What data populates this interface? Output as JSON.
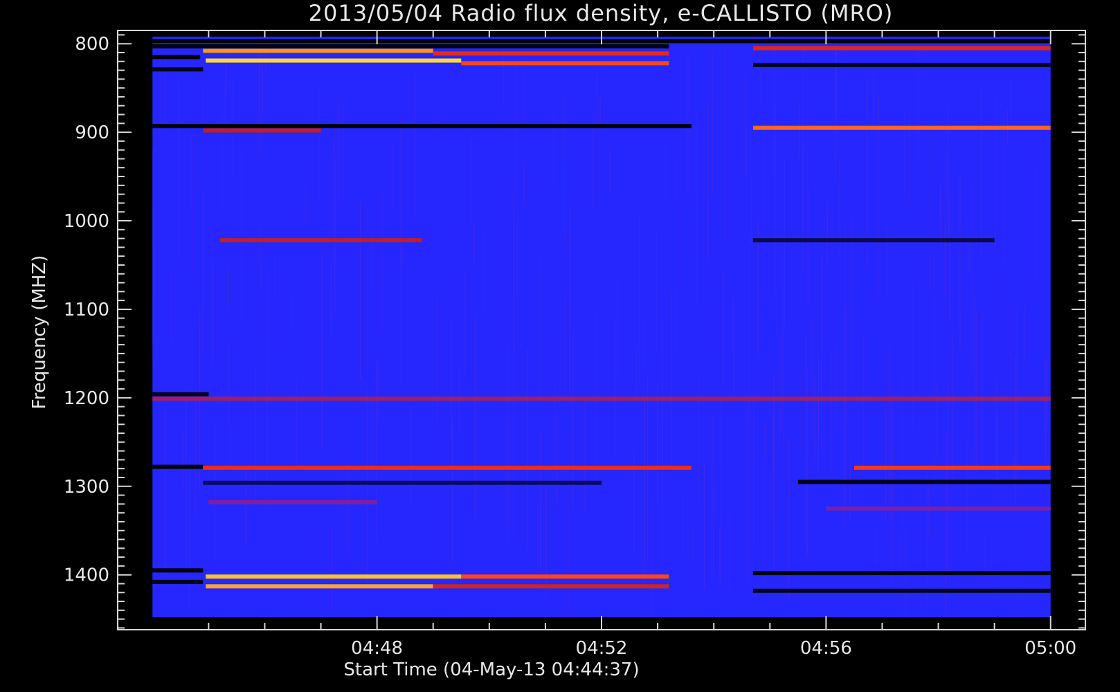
{
  "chart_data": {
    "type": "heatmap",
    "title": "2013/05/04  Radio flux density, e-CALLISTO (MRO)",
    "xlabel": "Start Time (04-May-13 04:44:37)",
    "ylabel": "Frequency (MHZ)",
    "x_start": "04:44:37",
    "x_end": "05:00:00",
    "xlim_minutes": [
      -0.62,
      16.62
    ],
    "ylim": [
      1462,
      785
    ],
    "y_data_range": [
      792,
      1448
    ],
    "y_inverted": true,
    "x_ticks": [
      {
        "label": "04:48",
        "minute": 4
      },
      {
        "label": "04:52",
        "minute": 8
      },
      {
        "label": "04:56",
        "minute": 12
      },
      {
        "label": "05:00",
        "minute": 16
      }
    ],
    "y_ticks": [
      {
        "label": "800",
        "value": 800
      },
      {
        "label": "900",
        "value": 900
      },
      {
        "label": "1000",
        "value": 1000
      },
      {
        "label": "1100",
        "value": 1100
      },
      {
        "label": "1200",
        "value": 1200
      },
      {
        "label": "1300",
        "value": 1300
      },
      {
        "label": "1400",
        "value": 1400
      }
    ],
    "x_minor_step": 1,
    "y_minor_step": 10,
    "colormap": [
      "#000000",
      "#0a0a4a",
      "#1a1aff",
      "#3030ff",
      "#8020a0",
      "#c02020",
      "#ff3010",
      "#ff9020",
      "#ffff40"
    ],
    "background_level": 0.32,
    "bands": [
      {
        "freq": 797,
        "t0": 0.0,
        "t1": 16.0,
        "level": 0.0
      },
      {
        "freq": 803,
        "t0": 0.0,
        "t1": 9.2,
        "level": 0.02
      },
      {
        "freq": 805,
        "t0": 10.7,
        "t1": 16.0,
        "level": 0.68
      },
      {
        "freq": 808,
        "t0": 0.9,
        "t1": 5.0,
        "level": 0.88
      },
      {
        "freq": 811,
        "t0": 5.0,
        "t1": 9.2,
        "level": 0.7
      },
      {
        "freq": 815,
        "t0": 0.0,
        "t1": 0.85,
        "level": 0.0
      },
      {
        "freq": 819,
        "t0": 0.95,
        "t1": 5.5,
        "level": 0.96
      },
      {
        "freq": 822,
        "t0": 5.5,
        "t1": 9.2,
        "level": 0.78
      },
      {
        "freq": 824,
        "t0": 10.7,
        "t1": 16.0,
        "level": 0.05
      },
      {
        "freq": 829,
        "t0": 0.0,
        "t1": 0.9,
        "level": 0.05
      },
      {
        "freq": 893,
        "t0": 0.0,
        "t1": 9.6,
        "level": 0.0
      },
      {
        "freq": 895,
        "t0": 10.7,
        "t1": 16.0,
        "level": 0.82
      },
      {
        "freq": 898,
        "t0": 0.9,
        "t1": 3.0,
        "level": 0.62
      },
      {
        "freq": 1022,
        "t0": 1.2,
        "t1": 4.8,
        "level": 0.62
      },
      {
        "freq": 1022,
        "t0": 10.7,
        "t1": 15.0,
        "level": 0.12
      },
      {
        "freq": 1196,
        "t0": 0.0,
        "t1": 1.0,
        "level": 0.05
      },
      {
        "freq": 1201,
        "t0": 0.0,
        "t1": 16.0,
        "level": 0.55
      },
      {
        "freq": 1278,
        "t0": 0.0,
        "t1": 0.9,
        "level": 0.0
      },
      {
        "freq": 1279,
        "t0": 0.9,
        "t1": 9.6,
        "level": 0.72
      },
      {
        "freq": 1279,
        "t0": 12.5,
        "t1": 16.0,
        "level": 0.76
      },
      {
        "freq": 1295,
        "t0": 11.5,
        "t1": 16.0,
        "level": 0.04
      },
      {
        "freq": 1296,
        "t0": 0.9,
        "t1": 8.0,
        "level": 0.14
      },
      {
        "freq": 1318,
        "t0": 1.0,
        "t1": 4.0,
        "level": 0.5
      },
      {
        "freq": 1325,
        "t0": 12.0,
        "t1": 16.0,
        "level": 0.48
      },
      {
        "freq": 1395,
        "t0": 0.0,
        "t1": 0.9,
        "level": 0.0
      },
      {
        "freq": 1398,
        "t0": 10.7,
        "t1": 16.0,
        "level": 0.02
      },
      {
        "freq": 1402,
        "t0": 0.95,
        "t1": 5.5,
        "level": 0.93
      },
      {
        "freq": 1402,
        "t0": 5.5,
        "t1": 9.2,
        "level": 0.78
      },
      {
        "freq": 1408,
        "t0": 0.0,
        "t1": 0.9,
        "level": 0.04
      },
      {
        "freq": 1413,
        "t0": 0.95,
        "t1": 5.0,
        "level": 0.9
      },
      {
        "freq": 1413,
        "t0": 5.0,
        "t1": 9.2,
        "level": 0.66
      },
      {
        "freq": 1418,
        "t0": 10.7,
        "t1": 16.0,
        "level": 0.05
      }
    ]
  }
}
